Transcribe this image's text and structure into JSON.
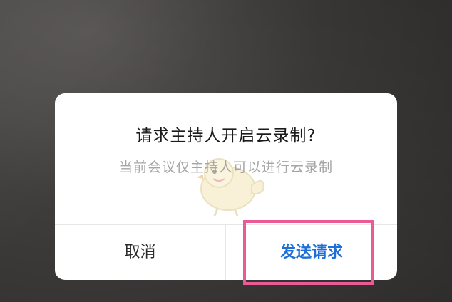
{
  "dialog": {
    "title": "请求主持人开启云录制?",
    "message": "当前会议仅主持人可以进行云录制",
    "cancel_label": "取消",
    "confirm_label": "发送请求"
  },
  "colors": {
    "confirm": "#1e6fd8",
    "highlight": "#ea5b95",
    "message": "#a5a5a5"
  },
  "overlay": {
    "mascot_icon": "bird-mascot-watermark",
    "highlight": "annotation-box-around-send-request"
  }
}
